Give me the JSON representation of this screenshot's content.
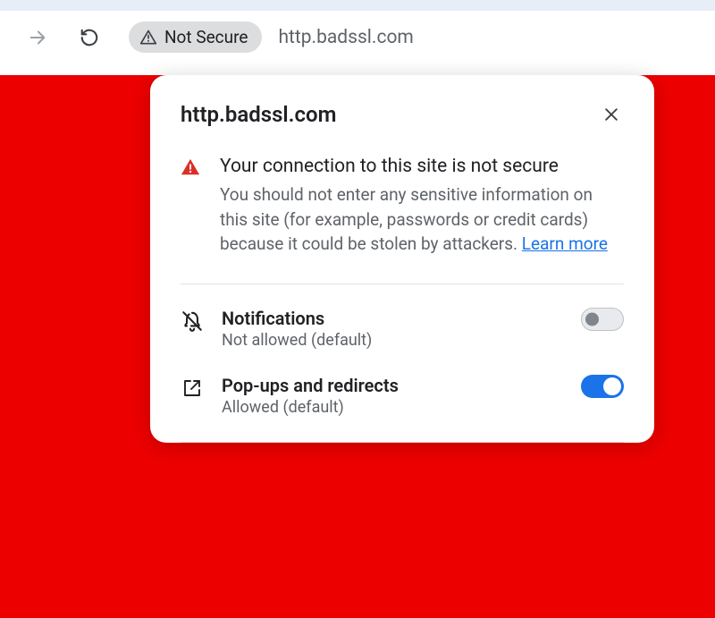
{
  "toolbar": {
    "security_label": "Not Secure",
    "url": "http.badssl.com"
  },
  "popover": {
    "title": "http.badssl.com",
    "security": {
      "heading": "Your connection to this site is not secure",
      "description": "You should not enter any sensitive information on this site (for example, passwords or credit cards) because it could be stolen by attackers. ",
      "learn_more": "Learn more"
    },
    "permissions": [
      {
        "name": "Notifications",
        "status": "Not allowed (default)",
        "enabled": false
      },
      {
        "name": "Pop-ups and redirects",
        "status": "Allowed (default)",
        "enabled": true
      }
    ]
  }
}
